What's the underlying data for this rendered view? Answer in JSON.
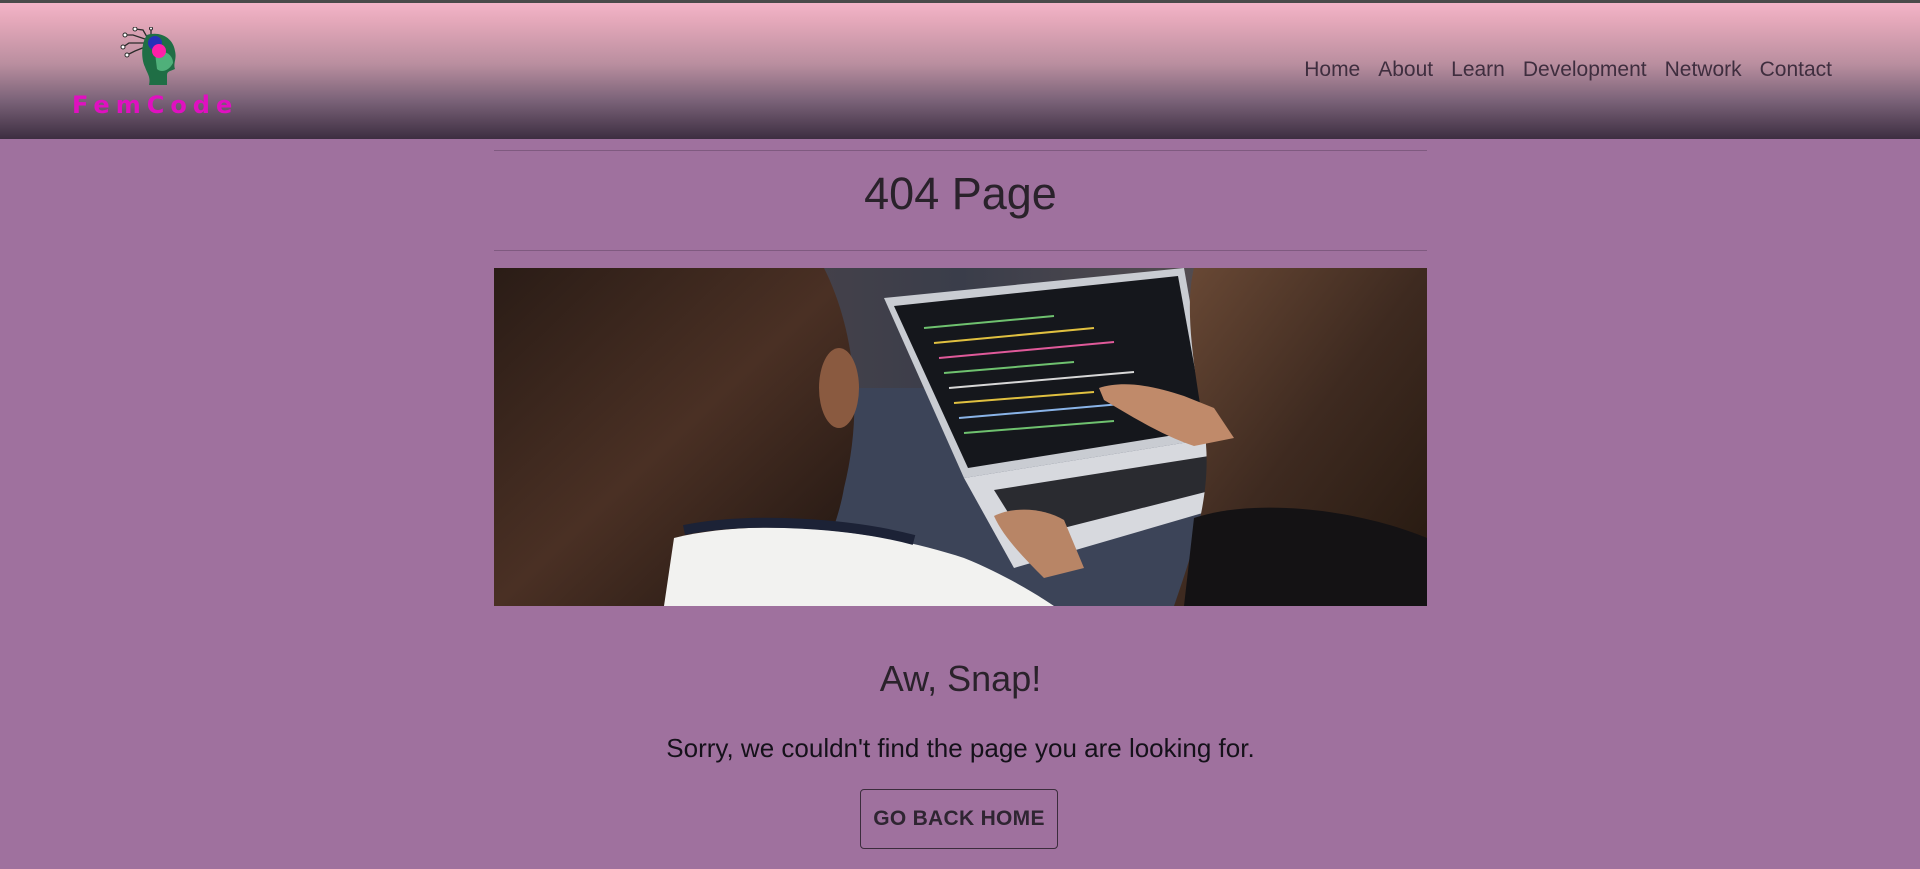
{
  "brand": {
    "name": "FemCode",
    "logo_icon": "woman-head-circuit-icon",
    "color": "#e010c0"
  },
  "nav": {
    "items": [
      {
        "label": "Home"
      },
      {
        "label": "About"
      },
      {
        "label": "Learn"
      },
      {
        "label": "Development"
      },
      {
        "label": "Network"
      },
      {
        "label": "Contact"
      }
    ]
  },
  "main": {
    "title": "404 Page",
    "heading": "Aw, Snap!",
    "message": "Sorry, we couldn't find the page you are looking for.",
    "button_label": "GO BACK HOME",
    "hero_image": "two-women-coding-on-laptop-photo"
  },
  "colors": {
    "page_background": "#9f719e",
    "header_top": "#f3b4c8",
    "header_bottom": "#3d2e41"
  }
}
